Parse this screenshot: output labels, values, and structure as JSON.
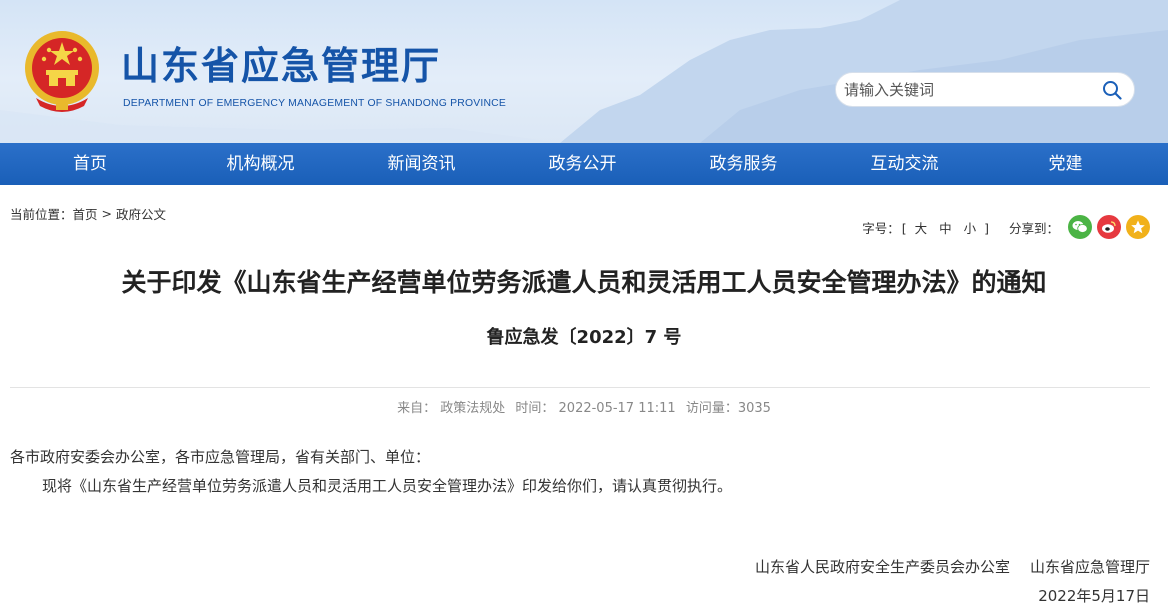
{
  "header": {
    "title": "山东省应急管理厅",
    "subtitle": "DEPARTMENT OF EMERGENCY MANAGEMENT OF SHANDONG PROVINCE",
    "search_placeholder": "请输入关键词"
  },
  "nav": {
    "items": [
      "首页",
      "机构概况",
      "新闻资讯",
      "政务公开",
      "政务服务",
      "互动交流",
      "党建"
    ]
  },
  "breadcrumb": {
    "label": "当前位置：",
    "home": "首页",
    "separator": ">",
    "current": "政府公文"
  },
  "tools": {
    "font_size_label": "字号：",
    "open_bracket": "[",
    "large": "大",
    "medium": "中",
    "small": "小",
    "close_bracket": "]",
    "share_label": "分享到："
  },
  "article": {
    "title": "关于印发《山东省生产经营单位劳务派遣人员和灵活用工人员安全管理办法》的通知",
    "doc_number": "鲁应急发〔2022〕7 号",
    "meta": {
      "source_label": "来自：",
      "source": "政策法规处",
      "time_label": "时间：",
      "time": "2022-05-17 11:11",
      "views_label": "访问量：",
      "views": "3035"
    },
    "salutation": "各市政府安委会办公室，各市应急管理局，省有关部门、单位：",
    "body": "现将《山东省生产经营单位劳务派遣人员和灵活用工人员安全管理办法》印发给你们，请认真贯彻执行。",
    "signature_org_1": "山东省人民政府安全生产委员会办公室",
    "signature_org_2": "山东省应急管理厅",
    "signature_date": "2022年5月17日"
  },
  "colors": {
    "brand_blue": "#1554a8",
    "nav_blue": "#1a5fb8",
    "wechat_green": "#4bb445",
    "weibo_red": "#e6393f",
    "star_yellow": "#f1b11a"
  }
}
